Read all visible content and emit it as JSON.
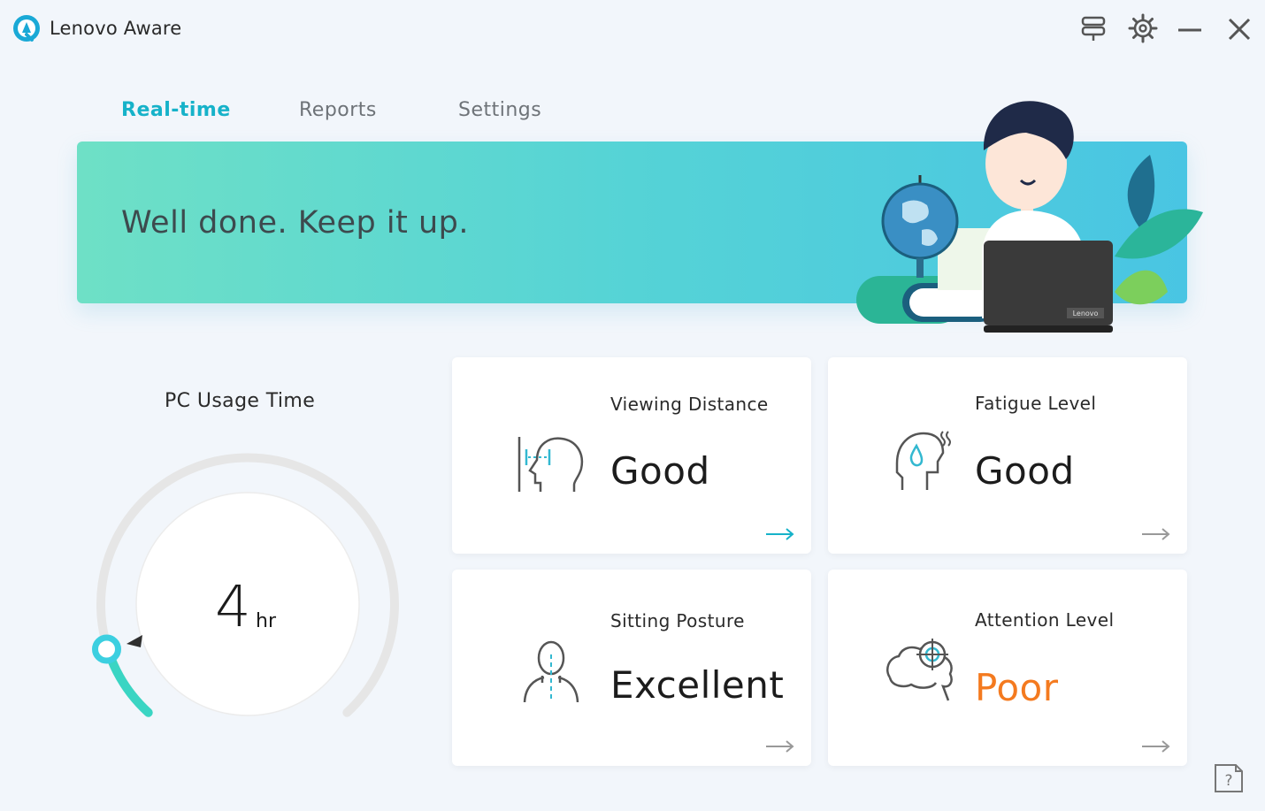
{
  "app": {
    "title": "Lenovo Aware"
  },
  "window_controls": [
    {
      "name": "feedback-icon"
    },
    {
      "name": "gear-icon"
    },
    {
      "name": "minimize-icon"
    },
    {
      "name": "close-icon"
    }
  ],
  "tabs": [
    {
      "label": "Real-time",
      "active": true
    },
    {
      "label": "Reports",
      "active": false
    },
    {
      "label": "Settings",
      "active": false
    }
  ],
  "banner": {
    "message": "Well done. Keep it up.",
    "laptop_brand": "Lenovo"
  },
  "usage": {
    "label": "PC Usage Time",
    "value": "4",
    "unit": "hr"
  },
  "cards": {
    "viewing": {
      "title": "Viewing Distance",
      "value": "Good",
      "icon": "head-distance-icon"
    },
    "fatigue": {
      "title": "Fatigue Level",
      "value": "Good",
      "icon": "eye-drop-head-icon"
    },
    "posture": {
      "title": "Sitting Posture",
      "value": "Excellent",
      "icon": "person-posture-icon"
    },
    "attention": {
      "title": "Attention Level",
      "value": "Poor",
      "icon": "brain-target-icon"
    }
  },
  "colors": {
    "accent": "#16b2c9",
    "poor": "#f47a1f",
    "banner_start": "#6ee0c6",
    "banner_end": "#49c5e3"
  }
}
